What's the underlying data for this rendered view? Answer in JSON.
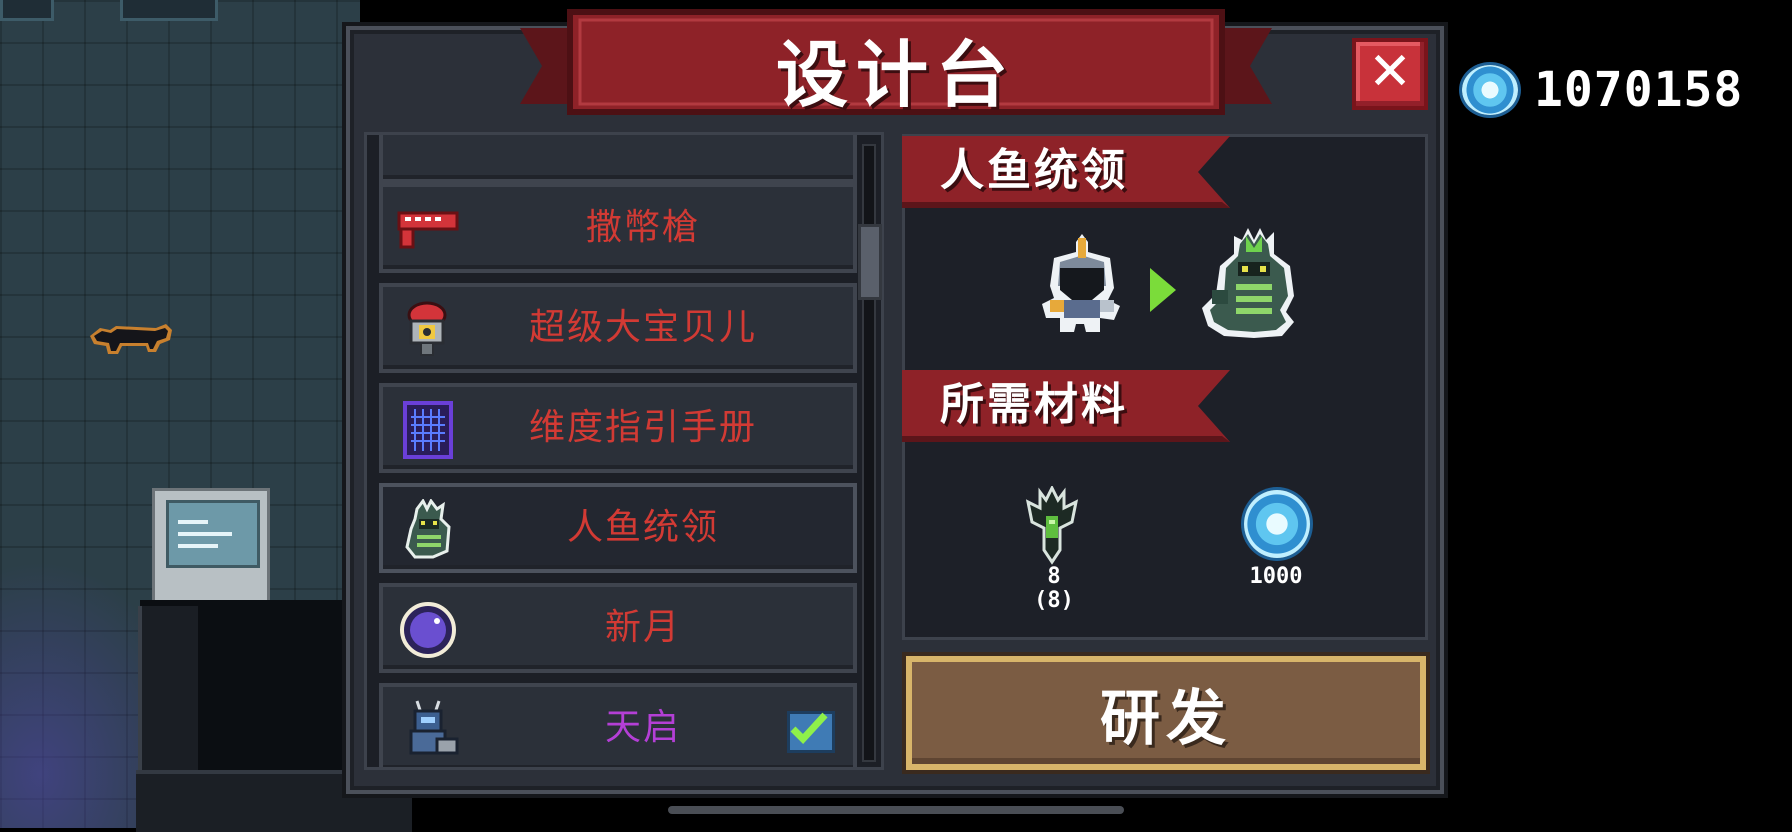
{
  "title": "设计台",
  "currency": {
    "icon": "gem-icon",
    "value": "1070158"
  },
  "list": {
    "items": [
      {
        "label": "",
        "color": "#d23a34",
        "icon": "none"
      },
      {
        "label": "撒幣槍",
        "color": "#d23a34",
        "icon": "red-gun-icon"
      },
      {
        "label": "超级大宝贝儿",
        "color": "#d23a34",
        "icon": "nuke-bomb-icon"
      },
      {
        "label": "维度指引手册",
        "color": "#d23a34",
        "icon": "grid-book-icon"
      },
      {
        "label": "人鱼统领",
        "color": "#d23a34",
        "icon": "merman-icon",
        "selected": true
      },
      {
        "label": "新月",
        "color": "#d23a34",
        "icon": "crescent-orb-icon"
      },
      {
        "label": "天启",
        "color": "#b43fd6",
        "icon": "mech-soldier-icon",
        "checked": true
      }
    ]
  },
  "detail": {
    "name": "人鱼统领",
    "materials_heading": "所需材料",
    "materials": [
      {
        "icon": "trident-part-icon",
        "amount": "8",
        "owned": "(8)"
      },
      {
        "icon": "gem-icon",
        "amount": "1000"
      }
    ]
  },
  "research_button": "研发",
  "colors": {
    "banner": "#8e2228",
    "accent_button": "#7b5c43",
    "close": "#c8323a"
  }
}
